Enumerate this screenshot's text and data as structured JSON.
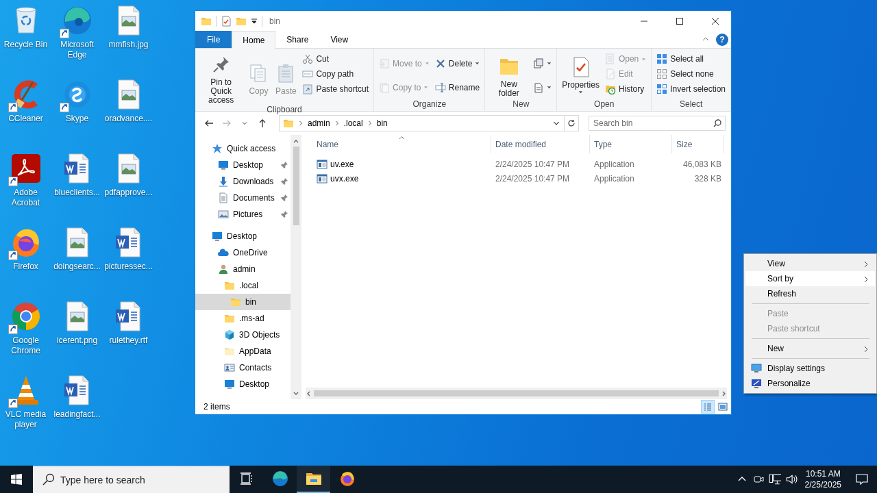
{
  "desktop_columns": [
    [
      {
        "label": "Recycle Bin",
        "kind": "recycle",
        "shortcut": false
      },
      {
        "label": "CCleaner",
        "kind": "ccleaner",
        "shortcut": true
      },
      {
        "label": "Adobe Acrobat",
        "kind": "acrobat",
        "shortcut": true
      },
      {
        "label": "Firefox",
        "kind": "firefox",
        "shortcut": true
      },
      {
        "label": "Google Chrome",
        "kind": "chrome",
        "shortcut": true
      },
      {
        "label": "VLC media player",
        "kind": "vlc",
        "shortcut": true
      }
    ],
    [
      {
        "label": "Microsoft Edge",
        "kind": "edge",
        "shortcut": true
      },
      {
        "label": "Skype",
        "kind": "skype",
        "shortcut": true
      },
      {
        "label": "blueclients...",
        "kind": "word",
        "shortcut": false
      },
      {
        "label": "doingsearc...",
        "kind": "image",
        "shortcut": false
      },
      {
        "label": "icerent.png",
        "kind": "image",
        "shortcut": false
      },
      {
        "label": "leadingfact...",
        "kind": "word",
        "shortcut": false
      }
    ],
    [
      {
        "label": "mmfish.jpg",
        "kind": "image",
        "shortcut": false
      },
      {
        "label": "oradvance....",
        "kind": "image",
        "shortcut": false
      },
      {
        "label": "pdfapprove...",
        "kind": "image",
        "shortcut": false
      },
      {
        "label": "picturessec...",
        "kind": "word",
        "shortcut": false
      },
      {
        "label": "rulethey.rtf",
        "kind": "word",
        "shortcut": false
      }
    ]
  ],
  "window": {
    "title": "bin",
    "ribbon": {
      "tabs": [
        {
          "label": "File",
          "kind": "file",
          "selected": false
        },
        {
          "label": "Home",
          "kind": "tab",
          "selected": true
        },
        {
          "label": "Share",
          "kind": "tab",
          "selected": false
        },
        {
          "label": "View",
          "kind": "tab",
          "selected": false
        }
      ],
      "help": "?",
      "groups": [
        {
          "label": "Clipboard",
          "columns": [
            [
              {
                "kind": "large",
                "label": "Pin to Quick access",
                "disabled": false,
                "dropdown": false
              }
            ],
            [
              {
                "kind": "large",
                "label": "Copy",
                "disabled": true,
                "dropdown": false
              }
            ],
            [
              {
                "kind": "large",
                "label": "Paste",
                "disabled": true,
                "dropdown": false
              }
            ],
            [
              {
                "kind": "small",
                "label": "Cut",
                "disabled": false,
                "dropdown": false
              },
              {
                "kind": "small",
                "label": "Copy path",
                "disabled": false,
                "dropdown": false
              },
              {
                "kind": "small",
                "label": "Paste shortcut",
                "disabled": false,
                "dropdown": false
              }
            ]
          ]
        },
        {
          "label": "Organize",
          "columns": [
            [
              {
                "kind": "small",
                "label": "Move to",
                "disabled": true,
                "dropdown": true
              },
              {
                "kind": "small",
                "label": "Copy to",
                "disabled": true,
                "dropdown": true
              }
            ],
            [
              {
                "kind": "small",
                "label": "Delete",
                "disabled": false,
                "dropdown": true
              },
              {
                "kind": "small",
                "label": "Rename",
                "disabled": false,
                "dropdown": false
              }
            ]
          ]
        },
        {
          "label": "New",
          "columns": [
            [
              {
                "kind": "large",
                "label": "New folder",
                "disabled": false,
                "dropdown": false
              }
            ],
            [
              {
                "kind": "icon",
                "disabled": false,
                "dropdown": true
              },
              {
                "kind": "icon",
                "disabled": false,
                "dropdown": true
              }
            ]
          ]
        },
        {
          "label": "Open",
          "columns": [
            [
              {
                "kind": "large",
                "label": "Properties",
                "disabled": false,
                "dropdown": true
              }
            ],
            [
              {
                "kind": "small",
                "label": "Open",
                "disabled": true,
                "dropdown": true
              },
              {
                "kind": "small",
                "label": "Edit",
                "disabled": true,
                "dropdown": false
              },
              {
                "kind": "small",
                "label": "History",
                "disabled": false,
                "dropdown": false
              }
            ]
          ]
        },
        {
          "label": "Select",
          "columns": [
            [
              {
                "kind": "small",
                "label": "Select all",
                "disabled": false,
                "dropdown": false
              },
              {
                "kind": "small",
                "label": "Select none",
                "disabled": false,
                "dropdown": false
              },
              {
                "kind": "small",
                "label": "Invert selection",
                "disabled": false,
                "dropdown": false
              }
            ]
          ]
        }
      ]
    },
    "breadcrumb": [
      "admin",
      ".local",
      "bin"
    ],
    "search": {
      "placeholder": "Search bin"
    },
    "nav_pane": [
      {
        "label": "Quick access",
        "kind": "quick",
        "selected": false,
        "children": [
          {
            "label": "Desktop",
            "kind": "desktop",
            "selected": false,
            "pinned": true
          },
          {
            "label": "Downloads",
            "kind": "downloads",
            "selected": false,
            "pinned": true
          },
          {
            "label": "Documents",
            "kind": "documents",
            "selected": false,
            "pinned": true
          },
          {
            "label": "Pictures",
            "kind": "pictures",
            "selected": false,
            "pinned": true
          }
        ]
      },
      {
        "label": "Desktop",
        "kind": "desktop",
        "selected": false,
        "children": [
          {
            "label": "OneDrive",
            "kind": "cloud",
            "selected": false
          },
          {
            "label": "admin",
            "kind": "user",
            "selected": false,
            "children": [
              {
                "label": ".local",
                "kind": "folder",
                "selected": false,
                "children": [
                  {
                    "label": "bin",
                    "kind": "folder",
                    "selected": true
                  }
                ]
              },
              {
                "label": ".ms-ad",
                "kind": "folder",
                "selected": false
              },
              {
                "label": "3D Objects",
                "kind": "cube",
                "selected": false
              },
              {
                "label": "AppData",
                "kind": "hidden-folder",
                "selected": false
              },
              {
                "label": "Contacts",
                "kind": "contacts",
                "selected": false
              },
              {
                "label": "Desktop",
                "kind": "desktop",
                "selected": false
              }
            ]
          }
        ]
      }
    ],
    "table": {
      "columns": [
        {
          "label": "Name",
          "sorted": true
        },
        {
          "label": "Date modified",
          "sorted": false
        },
        {
          "label": "Type",
          "sorted": false
        },
        {
          "label": "Size",
          "sorted": false
        }
      ],
      "rows": [
        {
          "name": "uv.exe",
          "date": "2/24/2025 10:47 PM",
          "type": "Application",
          "size": "46,083 KB"
        },
        {
          "name": "uvx.exe",
          "date": "2/24/2025 10:47 PM",
          "type": "Application",
          "size": "328 KB"
        }
      ]
    },
    "status_bar": {
      "count": "2 items",
      "views": [
        {
          "kind": "details",
          "selected": true
        },
        {
          "kind": "large-icons",
          "selected": false
        }
      ]
    }
  },
  "context_menu": [
    {
      "kind": "item",
      "label": "View",
      "submenu": true,
      "selected": false,
      "disabled": false
    },
    {
      "kind": "item",
      "label": "Sort by",
      "submenu": true,
      "selected": true,
      "disabled": false
    },
    {
      "kind": "item",
      "label": "Refresh",
      "submenu": false,
      "selected": false,
      "disabled": false
    },
    {
      "kind": "separator"
    },
    {
      "kind": "item",
      "label": "Paste",
      "submenu": false,
      "selected": false,
      "disabled": true
    },
    {
      "kind": "item",
      "label": "Paste shortcut",
      "submenu": false,
      "selected": false,
      "disabled": true
    },
    {
      "kind": "separator"
    },
    {
      "kind": "item",
      "label": "New",
      "submenu": true,
      "selected": false,
      "disabled": false
    },
    {
      "kind": "separator"
    },
    {
      "kind": "display",
      "label": "Display settings",
      "submenu": false,
      "selected": false,
      "disabled": false
    },
    {
      "kind": "personalize",
      "label": "Personalize",
      "submenu": false,
      "selected": false,
      "disabled": false
    }
  ],
  "taskbar": {
    "search": {
      "placeholder": "Type here to search"
    },
    "apps": [
      {
        "kind": "taskview",
        "active": false
      },
      {
        "kind": "edge",
        "active": false
      },
      {
        "kind": "explorer",
        "active": true
      },
      {
        "kind": "firefox",
        "active": false
      }
    ],
    "tray": [
      {
        "kind": "chevron"
      },
      {
        "kind": "camera"
      },
      {
        "kind": "network"
      },
      {
        "kind": "volume"
      }
    ],
    "time": "10:51 AM",
    "date": "2/25/2025"
  }
}
